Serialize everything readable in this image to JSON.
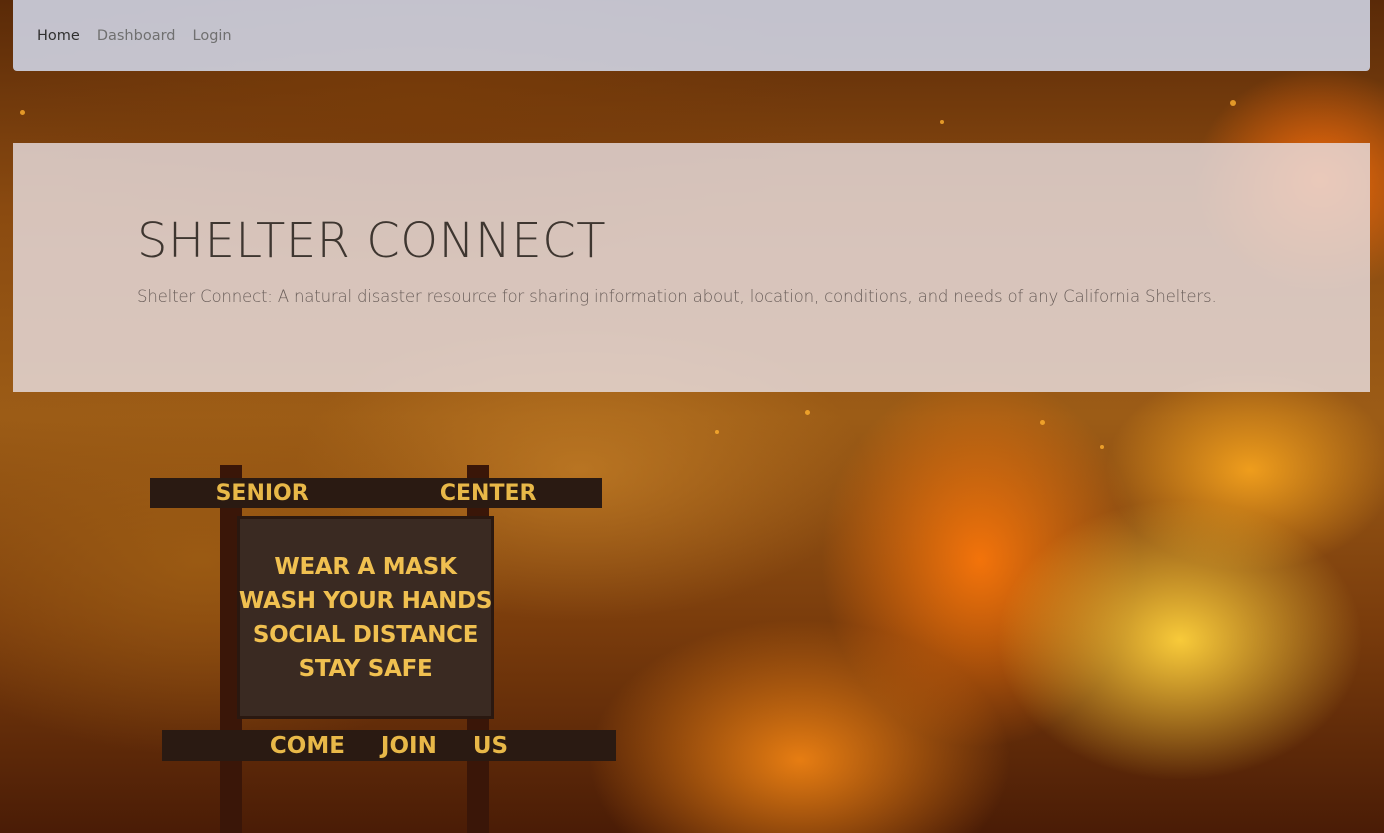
{
  "navbar": {
    "links": [
      {
        "label": "Home",
        "active": true
      },
      {
        "label": "Dashboard",
        "active": false
      },
      {
        "label": "Login",
        "active": false
      }
    ]
  },
  "hero": {
    "title": "SHELTER CONNECT",
    "description": "Shelter Connect: A natural disaster resource for sharing information about, location, conditions, and needs of any California Shelters."
  },
  "background_sign": {
    "top_left": "SENIOR",
    "top_right": "CENTER",
    "lines": [
      "WEAR A MASK",
      "WASH YOUR HANDS",
      "SOCIAL DISTANCE",
      "STAY SAFE"
    ],
    "bottom": [
      "COME",
      "JOIN",
      "US"
    ]
  },
  "colors": {
    "navbar_bg": "#d2d7e8",
    "jumbotron_bg": "#e8dee0",
    "title_text": "#3e3630",
    "fire_orange": "#ff8c1a",
    "sign_text": "#f0c050"
  }
}
